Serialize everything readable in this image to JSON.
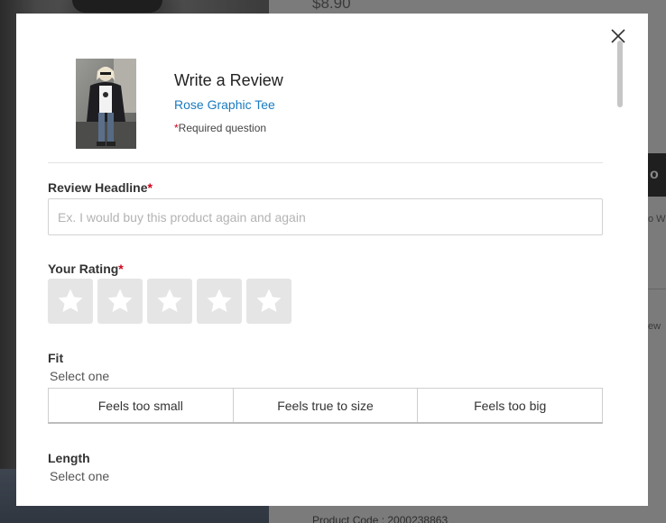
{
  "background_page": {
    "price": "$8.90",
    "button_text": "o",
    "side_text_1": "o W",
    "side_text_2": "ew",
    "product_code": "Product Code : 2000238863"
  },
  "modal": {
    "title": "Write a Review",
    "product_name": "Rose Graphic Tee",
    "required_star": "*",
    "required_note": "Required question",
    "close_icon": "close-icon",
    "headline": {
      "label": "Review Headline",
      "required_marker": "*",
      "placeholder": "Ex. I would buy this product again and again",
      "value": ""
    },
    "rating": {
      "label": "Your Rating",
      "required_marker": "*",
      "selected": 0,
      "max": 5,
      "star_icon": "star-icon"
    },
    "fit": {
      "label": "Fit",
      "hint": "Select one",
      "options": [
        "Feels too small",
        "Feels true to size",
        "Feels too big"
      ]
    },
    "length": {
      "label": "Length",
      "hint": "Select one"
    }
  },
  "colors": {
    "link": "#1a7bbf",
    "required": "#d0021b",
    "star_bg": "#e5e5e5",
    "overlay": "#6f6f6f"
  }
}
